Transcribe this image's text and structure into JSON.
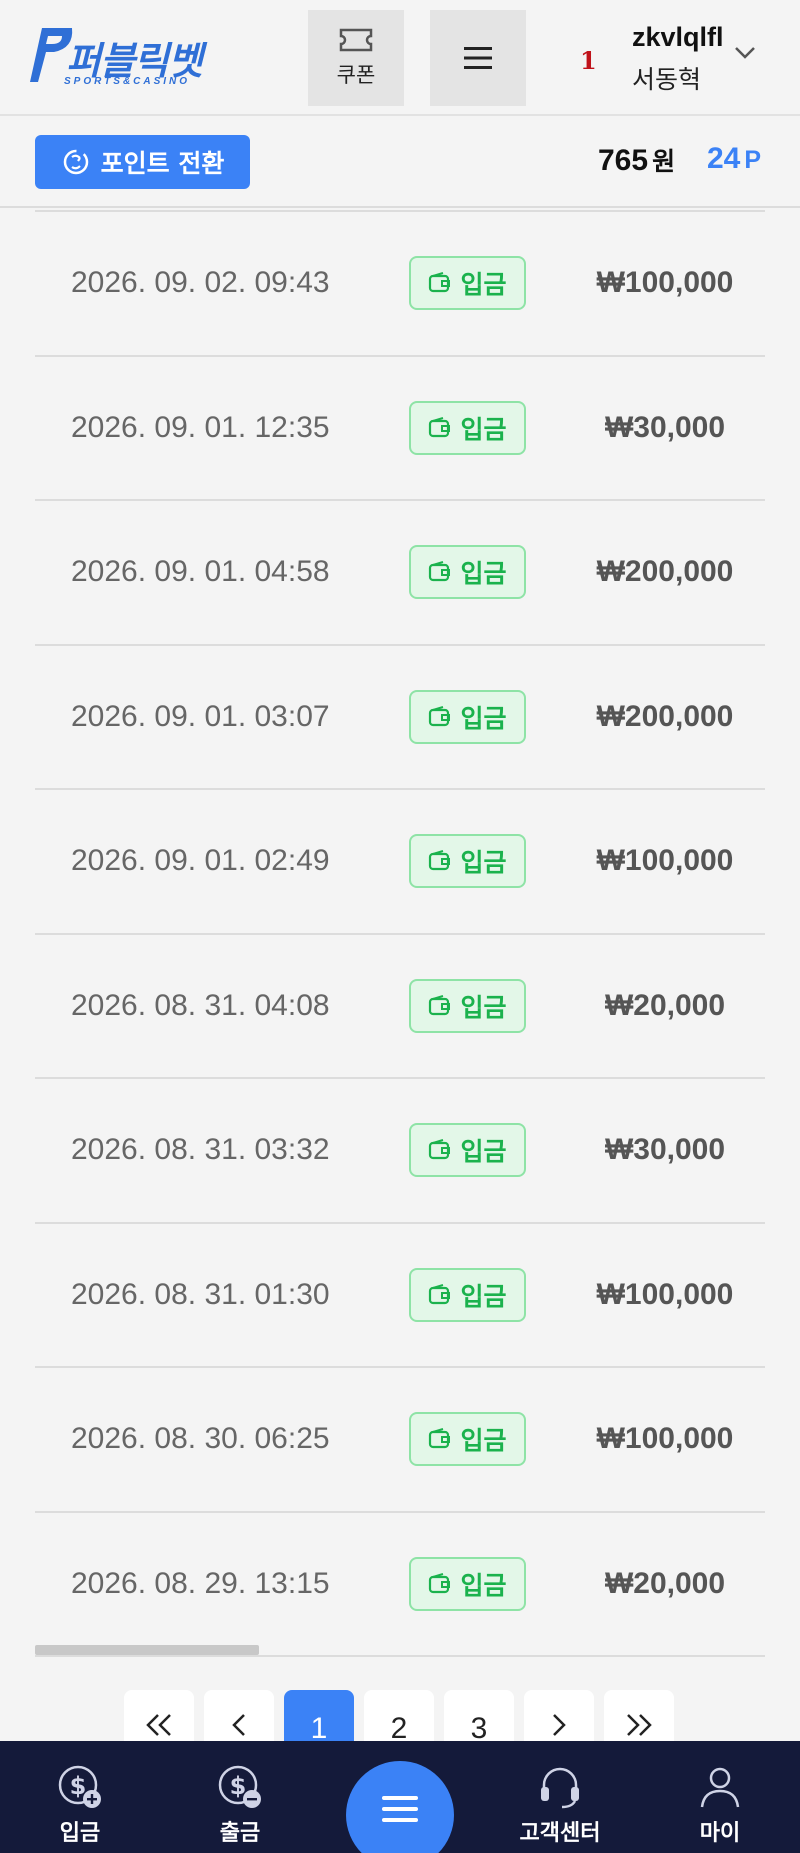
{
  "header": {
    "logo_text": "퍼블릭벳",
    "logo_sub": "SPORTS&CASINO",
    "coupon_label": "쿠폰",
    "user": {
      "level": "1",
      "username": "zkvlqlfl",
      "realname": "서동혁"
    }
  },
  "pointbar": {
    "convert_label": "포인트 전환",
    "balance": "765",
    "balance_unit": "원",
    "points": "24",
    "points_unit": "P"
  },
  "list": [
    {
      "date": "2026. 09. 02. 09:43",
      "type": "입금",
      "amount": "₩100,000"
    },
    {
      "date": "2026. 09. 01. 12:35",
      "type": "입금",
      "amount": "₩30,000"
    },
    {
      "date": "2026. 09. 01. 04:58",
      "type": "입금",
      "amount": "₩200,000"
    },
    {
      "date": "2026. 09. 01. 03:07",
      "type": "입금",
      "amount": "₩200,000"
    },
    {
      "date": "2026. 09. 01. 02:49",
      "type": "입금",
      "amount": "₩100,000"
    },
    {
      "date": "2026. 08. 31. 04:08",
      "type": "입금",
      "amount": "₩20,000"
    },
    {
      "date": "2026. 08. 31. 03:32",
      "type": "입금",
      "amount": "₩30,000"
    },
    {
      "date": "2026. 08. 31. 01:30",
      "type": "입금",
      "amount": "₩100,000"
    },
    {
      "date": "2026. 08. 30. 06:25",
      "type": "입금",
      "amount": "₩100,000"
    },
    {
      "date": "2026. 08. 29. 13:15",
      "type": "입금",
      "amount": "₩20,000"
    }
  ],
  "pagination": {
    "first": "«",
    "prev": "‹",
    "pages": [
      "1",
      "2",
      "3"
    ],
    "active_page": "1",
    "next": "›",
    "last": "»"
  },
  "bottomnav": {
    "deposit": "입금",
    "withdraw": "출금",
    "support": "고객센터",
    "my": "마이"
  },
  "colors": {
    "accent": "#3b82f6",
    "badge_bg": "#e3f7e8",
    "badge_text": "#1bb24d",
    "nav_bg": "#141a3a",
    "level": "#c0121a"
  }
}
